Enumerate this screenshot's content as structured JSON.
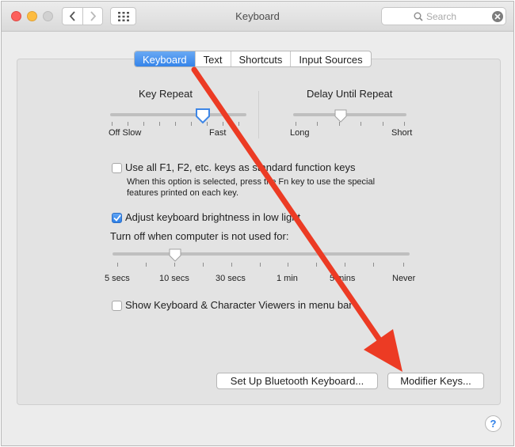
{
  "window": {
    "title": "Keyboard"
  },
  "search": {
    "placeholder": "Search"
  },
  "tabs": [
    "Keyboard",
    "Text",
    "Shortcuts",
    "Input Sources"
  ],
  "key_repeat": {
    "title": "Key Repeat",
    "min_label": "Off Slow",
    "max_label": "Fast"
  },
  "delay_until_repeat": {
    "title": "Delay Until Repeat",
    "min_label": "Long",
    "max_label": "Short"
  },
  "fn_keys": {
    "label": "Use all F1, F2, etc. keys as standard function keys",
    "checked": false,
    "description_line1": "When this option is selected, press the Fn key to use the special",
    "description_line2": "features printed on each key."
  },
  "brightness": {
    "label": "Adjust keyboard brightness in low light",
    "checked": true
  },
  "turn_off": {
    "label": "Turn off when computer is not used for:",
    "stops": [
      "5 secs",
      "10 secs",
      "30 secs",
      "1 min",
      "5 mins",
      "Never"
    ]
  },
  "viewers": {
    "label": "Show Keyboard & Character Viewers in menu bar",
    "checked": false
  },
  "buttons": {
    "bluetooth": "Set Up Bluetooth Keyboard...",
    "modifier": "Modifier Keys..."
  },
  "help": {
    "label": "?"
  },
  "colors": {
    "accent": "#2f80e8",
    "annotation_arrow": "#ec3b24"
  },
  "icons": [
    "back-chevron-icon",
    "forward-chevron-icon",
    "grid-icon",
    "search-icon",
    "clear-icon",
    "checkmark-icon",
    "annotation-arrow"
  ]
}
